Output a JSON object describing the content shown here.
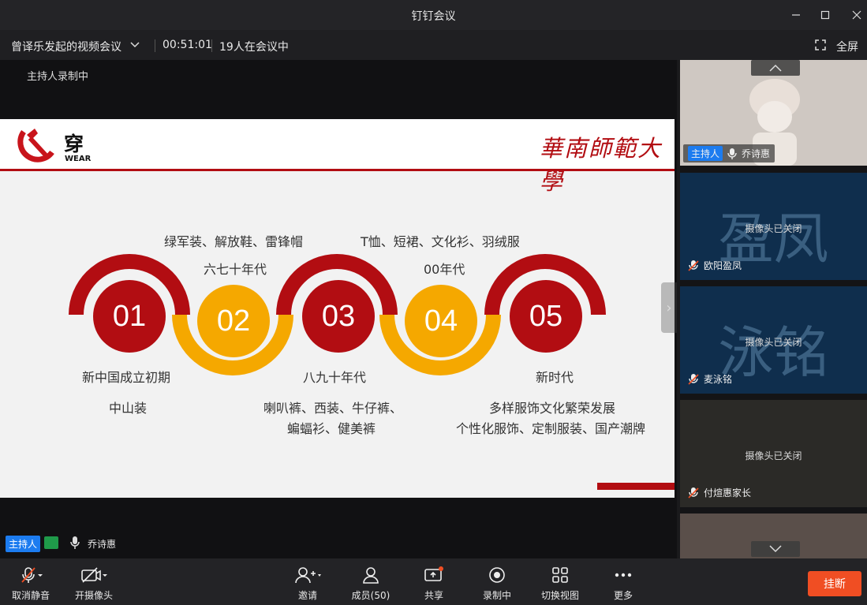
{
  "window": {
    "title": "钉钉会议"
  },
  "info": {
    "meeting_name": "曾译乐发起的视频会议",
    "duration": "00:51:01",
    "participants": "19人在会议中",
    "fullscreen": "全屏"
  },
  "stage": {
    "recording_note": "主持人录制中",
    "host_tag": "主持人",
    "host_name": "乔诗惠"
  },
  "slide": {
    "title": "穿",
    "subtitle": "WEAR",
    "university": "華南師範大學",
    "items": [
      {
        "num": "01",
        "era": "新中国成立初期",
        "clothes": "中山装"
      },
      {
        "num": "02",
        "era": "六七十年代",
        "clothes": "绿军装、解放鞋、雷锋帽"
      },
      {
        "num": "03",
        "era": "八九十年代",
        "clothes_line1": "喇叭裤、西装、牛仔裤、",
        "clothes_line2": "蝙蝠衫、健美裤"
      },
      {
        "num": "04",
        "era": "00年代",
        "clothes": "T恤、短裙、文化衫、羽绒服"
      },
      {
        "num": "05",
        "era": "新时代",
        "clothes_line1": "多样服饰文化繁荣发展",
        "clothes_line2": "个性化服饰、定制服装、国产潮牌"
      }
    ]
  },
  "panel": {
    "tiles": [
      {
        "host_tag": "主持人",
        "name": "乔诗惠"
      },
      {
        "initials": "盈凤",
        "status": "摄像头已关闭",
        "name": "欧阳盈凤"
      },
      {
        "initials": "泳铭",
        "status": "摄像头已关闭",
        "name": "麦泳铭"
      },
      {
        "status": "摄像头已关闭",
        "name": "付煊惠家长"
      }
    ]
  },
  "toolbar": {
    "unmute": "取消静音",
    "camera": "开摄像头",
    "invite": "邀请",
    "members": "成员(50)",
    "share": "共享",
    "recording": "录制中",
    "switch_view": "切换视图",
    "more": "更多",
    "hangup": "挂断"
  },
  "colors": {
    "red": "#b20d12",
    "orange": "#f5a800",
    "accent": "#1c7cf0",
    "hangup": "#f04e23"
  }
}
